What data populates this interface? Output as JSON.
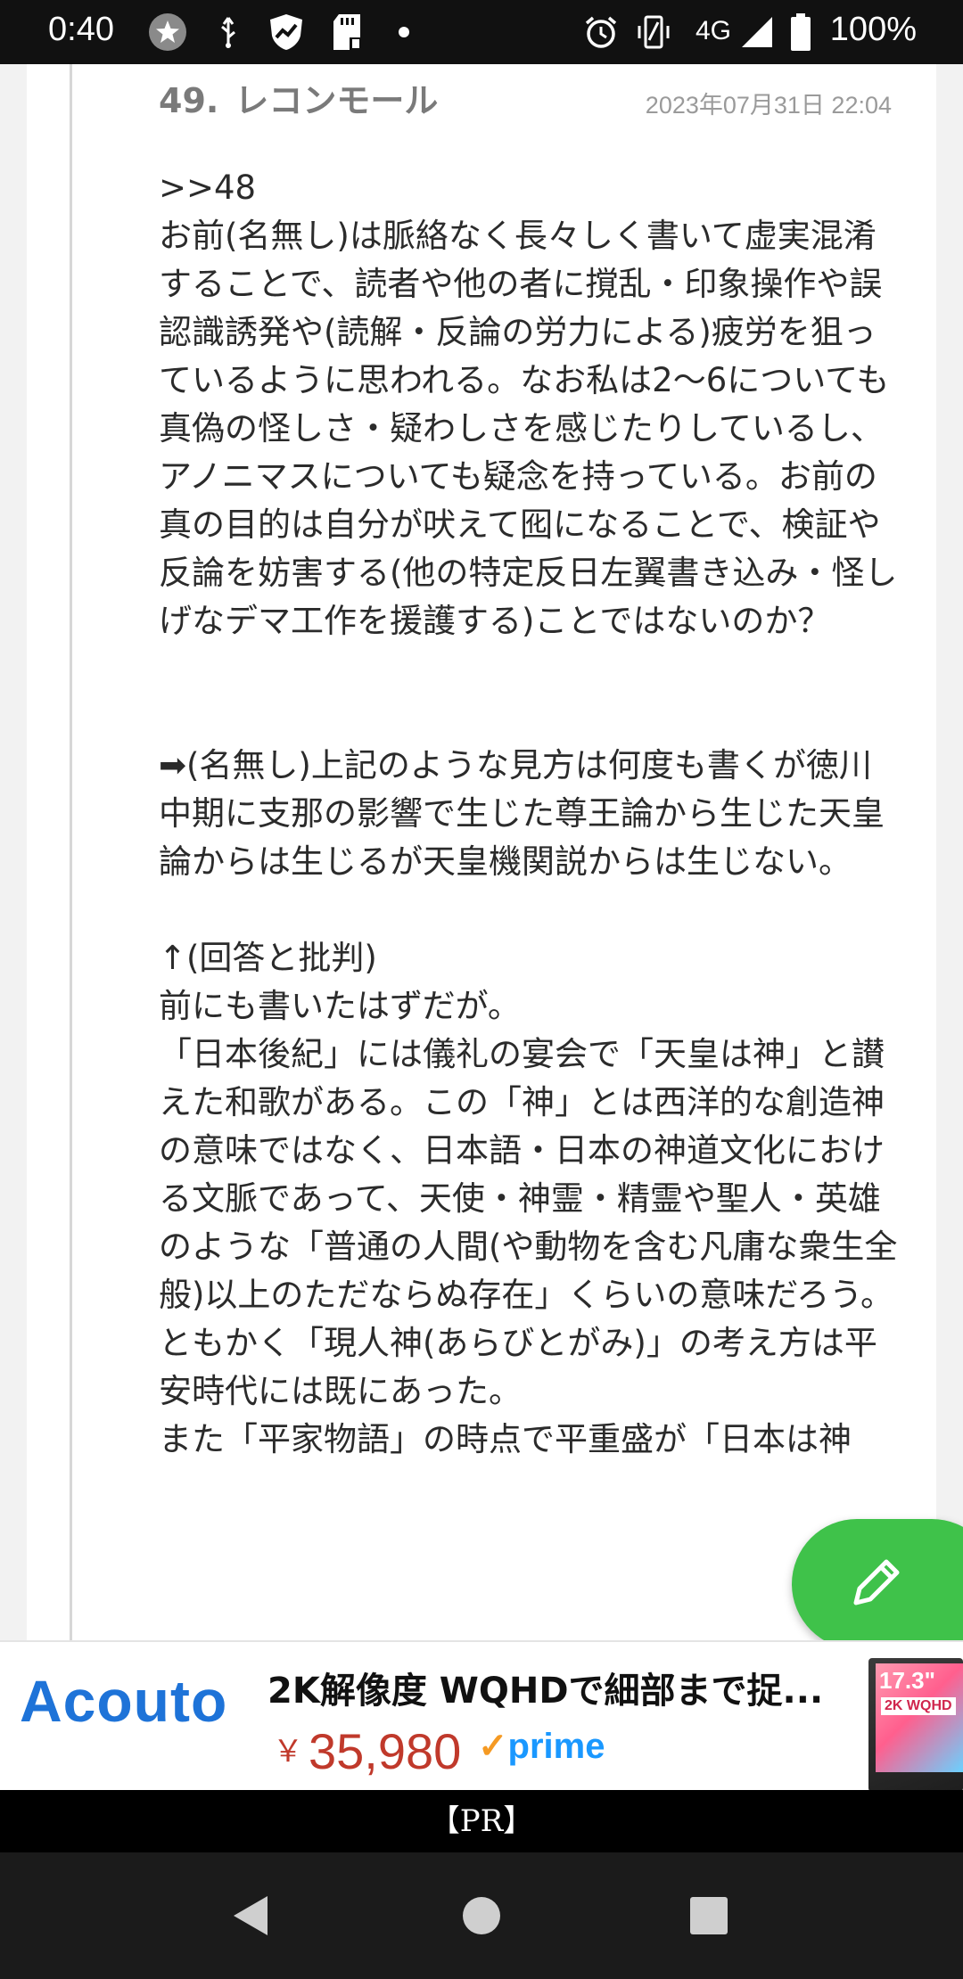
{
  "status_bar": {
    "time": "0:40",
    "network": "4G",
    "battery": "100%",
    "icons": [
      "star-circle-icon",
      "usb-icon",
      "shield-graph-icon",
      "sd-card-icon",
      "dot-icon",
      "alarm-icon",
      "vibrate-icon",
      "signal-icon",
      "battery-icon"
    ]
  },
  "post": {
    "number": "49.",
    "author": "レコンモール",
    "date": "2023年07月31日 22:04",
    "paragraphs": [
      ">>48\nお前(名無し)は脈絡なく長々しく書いて虚実混淆することで、読者や他の者に撹乱・印象操作や誤認識誘発や(読解・反論の労力による)疲労を狙っているように思われる。なお私は2〜6についても真偽の怪しさ・疑わしさを感じたりしているし、アノニマスについても疑念を持っている。お前の真の目的は自分が吠えて囮になることで、検証や反論を妨害する(他の特定反日左翼書き込み・怪しげなデマ工作を援護する)ことではないのか？",
      "➡(名無し)上記のような見方は何度も書くが徳川中期に支那の影響で生じた尊王論から生じた天皇論からは生じるが天皇機関説からは生じない。",
      "↑(回答と批判)\n前にも書いたはずだが。\n「日本後紀」には儀礼の宴会で「天皇は神」と讃えた和歌がある。この「神」とは西洋的な創造神の意味ではなく、日本語・日本の神道文化における文脈であって、天使・神霊・精霊や聖人・英雄のような「普通の人間(や動物を含む凡庸な衆生全般)以上のただならぬ存在」くらいの意味だろう。ともかく「現人神(あらびとがみ)」の考え方は平安時代には既にあった。\nまた「平家物語」の時点で平重盛が「日本は神"
    ]
  },
  "fab": {
    "icon": "pencil-icon",
    "color": "#3fc24a"
  },
  "ad": {
    "brand": "Acouto",
    "title": "2K解像度 WQHDで細部まで捉...",
    "currency": "￥",
    "price": "35,980",
    "prime_label": "prime",
    "image_label": "17.3\"",
    "image_badge": "2K WQHD",
    "pr_label": "【PR】"
  },
  "nav_bar": {
    "buttons": [
      "back-icon",
      "home-icon",
      "recents-icon"
    ]
  }
}
